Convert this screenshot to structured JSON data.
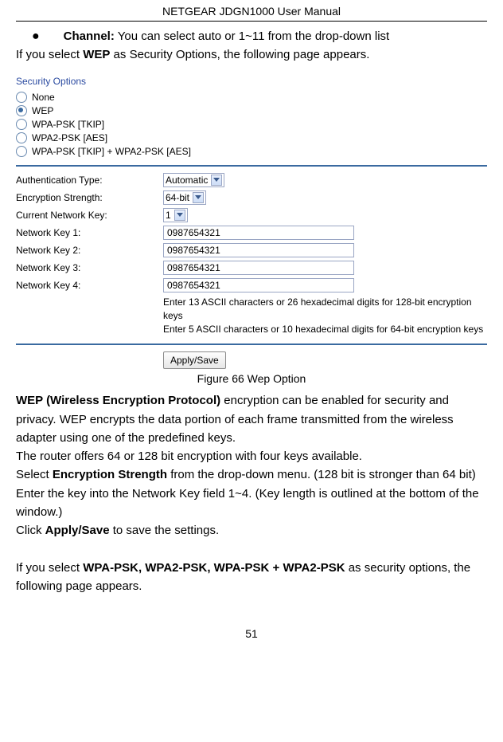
{
  "header": {
    "title": "NETGEAR JDGN1000 User Manual"
  },
  "bullet": {
    "label": "Channel:",
    "text": " You can select auto or 1~11 from the drop-down list"
  },
  "intro": {
    "prefix": "If you select ",
    "bold": "WEP",
    "suffix": " as Security Options, the following page appears."
  },
  "fig": {
    "sectionLabel": "Security Options",
    "radios": [
      {
        "label": "None",
        "selected": false
      },
      {
        "label": "WEP",
        "selected": true
      },
      {
        "label": "WPA-PSK [TKIP]",
        "selected": false
      },
      {
        "label": "WPA2-PSK [AES]",
        "selected": false
      },
      {
        "label": "WPA-PSK [TKIP] + WPA2-PSK [AES]",
        "selected": false
      }
    ],
    "rows": {
      "auth": {
        "label": "Authentication Type:",
        "value": "Automatic"
      },
      "enc": {
        "label": "Encryption Strength:",
        "value": "64-bit"
      },
      "curkey": {
        "label": "Current Network Key:",
        "value": "1"
      },
      "k1": {
        "label": "Network Key 1:",
        "value": "0987654321"
      },
      "k2": {
        "label": "Network Key 2:",
        "value": "0987654321"
      },
      "k3": {
        "label": "Network Key 3:",
        "value": "0987654321"
      },
      "k4": {
        "label": "Network Key 4:",
        "value": "0987654321"
      }
    },
    "hints": {
      "h1": "Enter 13 ASCII characters or 26 hexadecimal digits for 128-bit encryption keys",
      "h2": "Enter 5 ASCII characters or 10 hexadecimal digits for 64-bit encryption keys"
    },
    "applyBtn": "Apply/Save",
    "caption": "Figure 66 Wep Option"
  },
  "body": {
    "p1a": "WEP (Wireless Encryption Protocol)",
    "p1b": " encryption can be enabled for security and privacy. WEP encrypts the data portion of each frame transmitted from the wireless adapter using one of the predefined keys.",
    "p2": "The router offers 64 or 128 bit encryption with four keys available.",
    "p3a": "Select ",
    "p3b": "Encryption Strength",
    "p3c": " from the drop-down menu. (128 bit is stronger than 64 bit)",
    "p4": "Enter the key into the Network Key field 1~4. (Key length is outlined at the bottom of the window.)",
    "p5a": "Click ",
    "p5b": "Apply/Save",
    "p5c": " to save the settings.",
    "p6a": "If you select ",
    "p6b": "WPA-PSK, WPA2-PSK, WPA-PSK + WPA2-PSK",
    "p6c": " as security options, the following page appears."
  },
  "pageNumber": "51"
}
